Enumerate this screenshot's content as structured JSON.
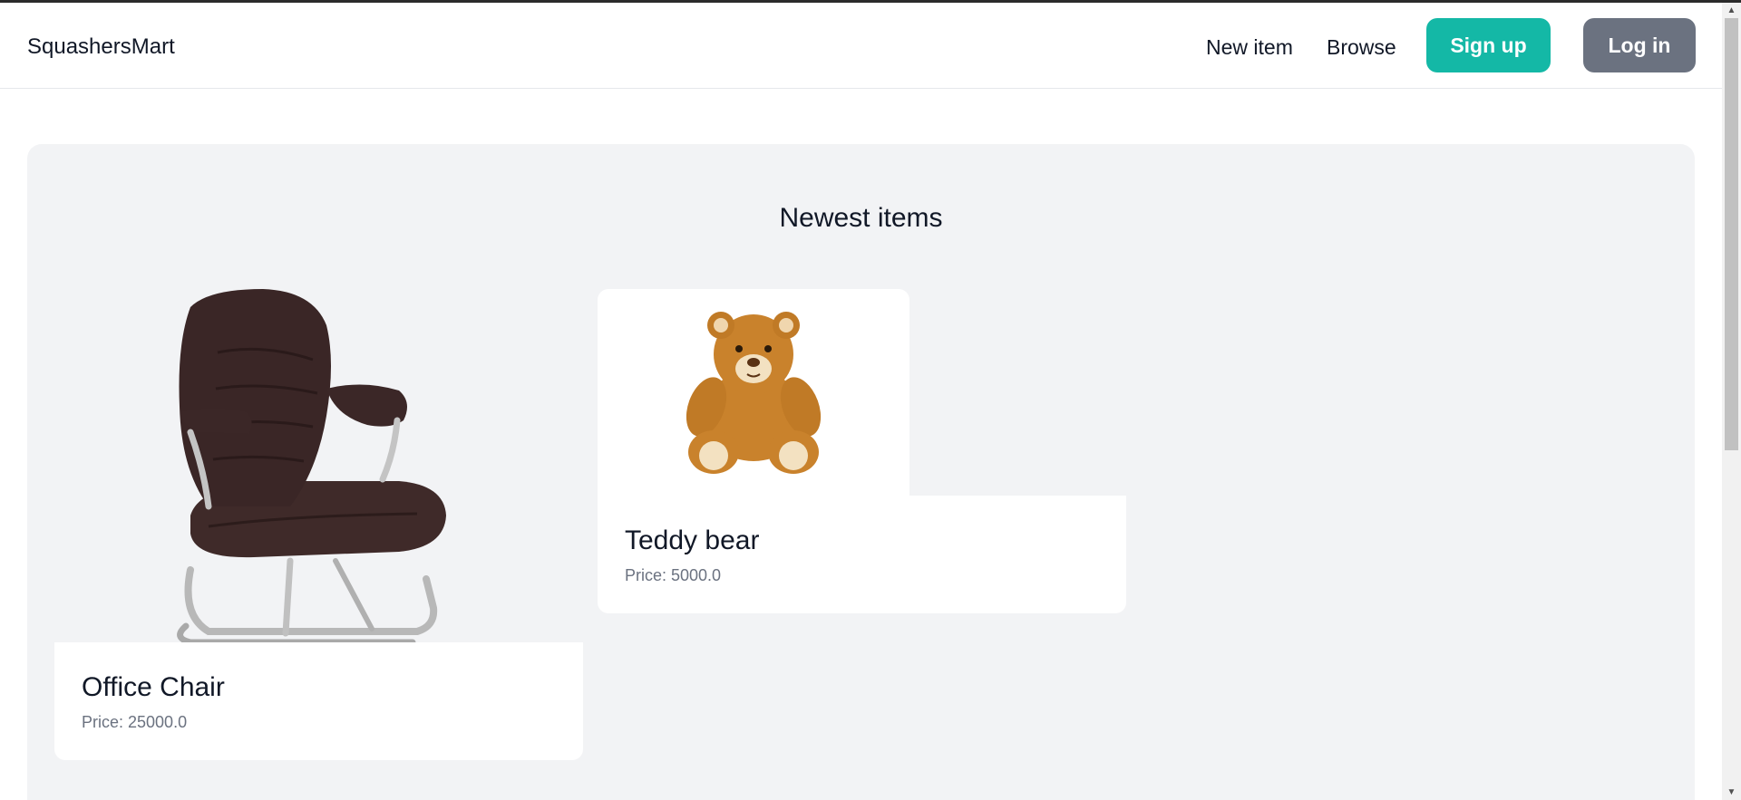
{
  "navbar": {
    "brand": "SquashersMart",
    "links": {
      "new_item": "New item",
      "browse": "Browse"
    },
    "buttons": {
      "signup": "Sign up",
      "login": "Log in"
    }
  },
  "main": {
    "title": "Newest items",
    "items": [
      {
        "name": "Office Chair",
        "price": "Price: 25000.0",
        "image": "office-chair"
      },
      {
        "name": "Teddy bear",
        "price": "Price: 5000.0",
        "image": "teddy-bear"
      }
    ]
  },
  "colors": {
    "signup": "#14b8a6",
    "login": "#6b7280",
    "panel": "#f2f3f5"
  }
}
